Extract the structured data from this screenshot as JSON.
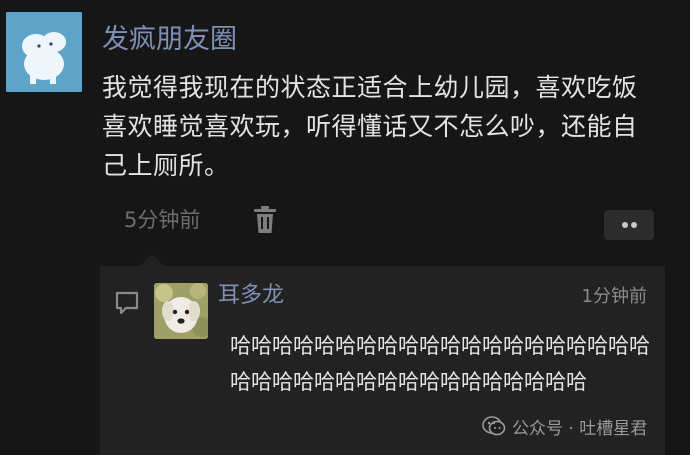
{
  "post": {
    "username": "发疯朋友圈",
    "content": "我觉得我现在的状态正适合上幼儿园，喜欢吃饭喜欢睡觉喜欢玩，听得懂话又不怎么吵，还能自己上厕所。",
    "time": "5分钟前",
    "delete_icon": "trash-icon",
    "more_icon": "more-dots-icon"
  },
  "comment": {
    "icon": "comment-icon",
    "author": "耳多龙",
    "time": "1分钟前",
    "text": "哈哈哈哈哈哈哈哈哈哈哈哈哈哈哈哈哈哈哈哈哈哈哈哈哈哈哈哈哈哈哈哈哈哈哈哈哈"
  },
  "watermark": {
    "icon": "wechat-official-account-icon",
    "text": "公众号 · 吐槽星君"
  },
  "colors": {
    "background": "#161616",
    "name_link": "#7f8fb5",
    "text": "#e3e3e3",
    "comment_bg": "#222222"
  }
}
